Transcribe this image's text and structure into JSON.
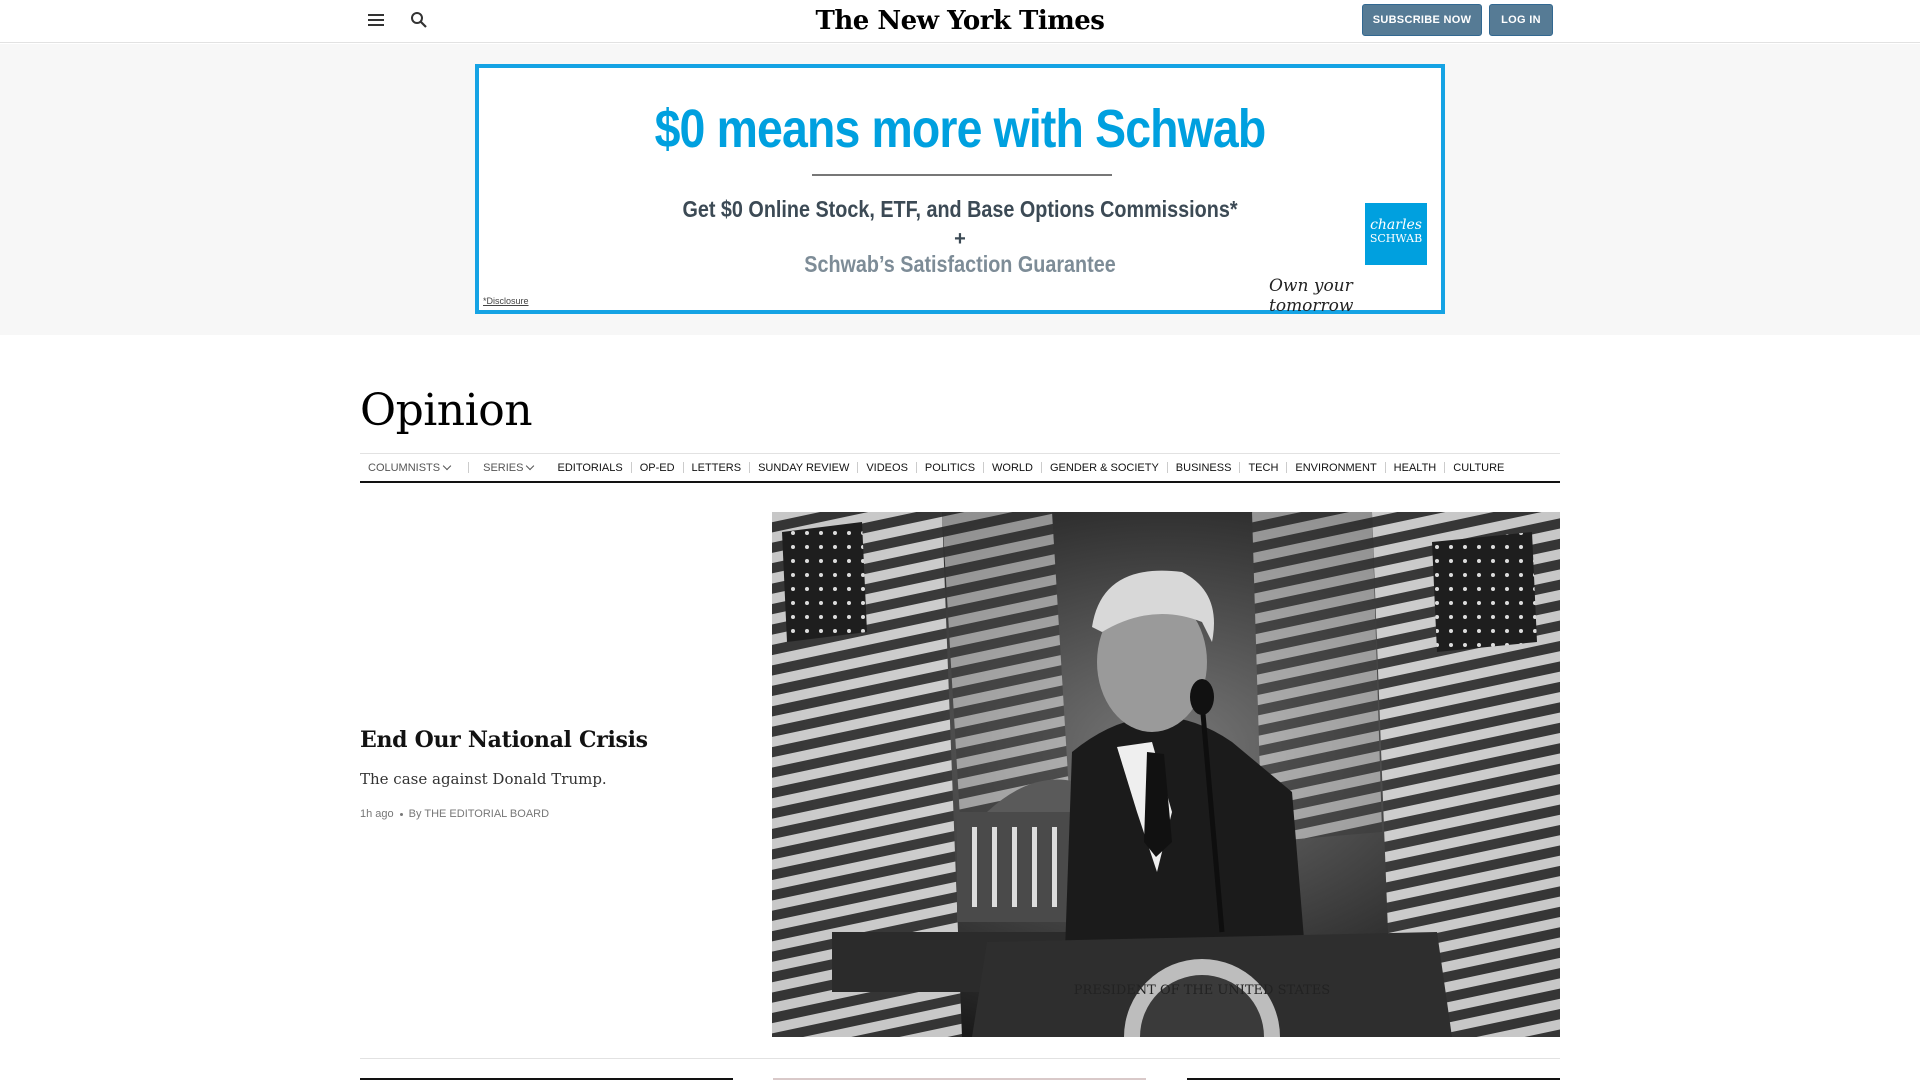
{
  "header": {
    "logo_text": "The New York Times",
    "subscribe_label": "SUBSCRIBE NOW",
    "login_label": "LOG IN",
    "icons": [
      "menu-icon",
      "search-icon"
    ]
  },
  "ad": {
    "headline": "$0 means more with Schwab",
    "line1": "Get $0 Online Stock, ETF, and Base Options Commissions*",
    "plus": "+",
    "line2": "Schwab’s Satisfaction Guarantee",
    "logo_top": "charles",
    "logo_bottom": "SCHWAB",
    "tagline": "Own your tomorrow",
    "disclosure": "*Disclosure",
    "accent_color": "#15a3e4"
  },
  "section": {
    "title": "Opinion",
    "nav": [
      {
        "label": "COLUMNISTS",
        "dropdown": true
      },
      {
        "label": "SERIES",
        "dropdown": true
      },
      {
        "label": "EDITORIALS"
      },
      {
        "label": "OP-ED"
      },
      {
        "label": "LETTERS"
      },
      {
        "label": "SUNDAY REVIEW"
      },
      {
        "label": "VIDEOS"
      },
      {
        "label": "POLITICS"
      },
      {
        "label": "WORLD"
      },
      {
        "label": "GENDER & SOCIETY"
      },
      {
        "label": "BUSINESS"
      },
      {
        "label": "TECH"
      },
      {
        "label": "ENVIRONMENT"
      },
      {
        "label": "HEALTH"
      },
      {
        "label": "CULTURE"
      }
    ]
  },
  "lead_story": {
    "headline": "End Our National Crisis",
    "summary": "The case against Donald Trump.",
    "time": "1h ago",
    "byline": "By THE EDITORIAL BOARD",
    "podium_seal_text": "PRESIDENT OF THE UNITED STATES"
  }
}
